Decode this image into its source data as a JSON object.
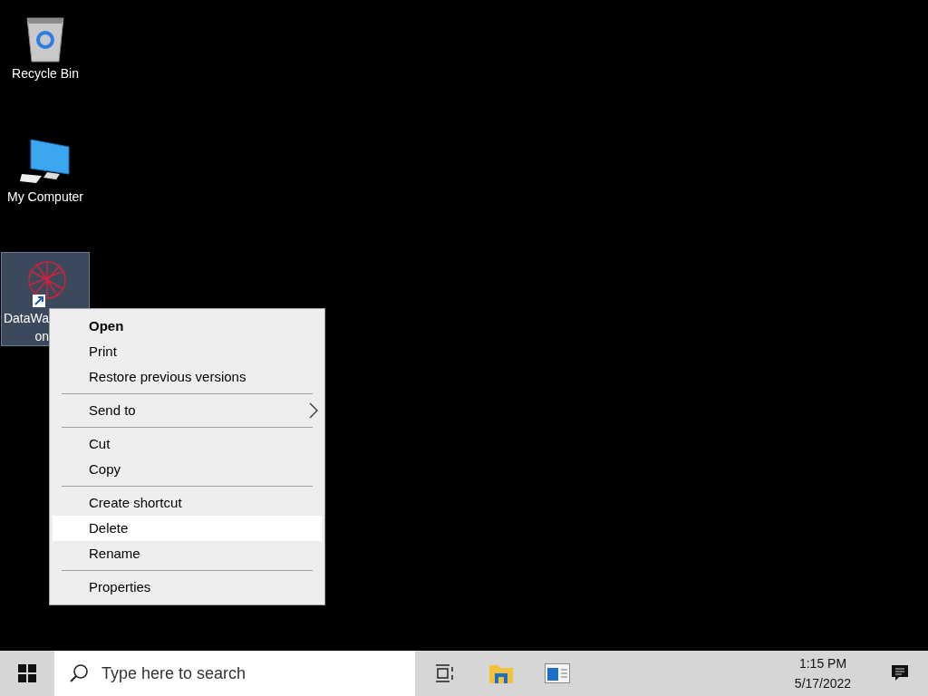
{
  "desktop_icons": [
    {
      "kind": "recycle-bin",
      "label_lines": [
        "Recycle Bin"
      ],
      "selected": false
    },
    {
      "kind": "computer",
      "label_lines": [
        "My Computer"
      ],
      "selected": false
    },
    {
      "kind": "shortcut",
      "label_lines": [
        "DataWa",
        "on"
      ],
      "selected": true
    }
  ],
  "context_menu": {
    "items": [
      {
        "kind": "item",
        "label": "Open",
        "default": true,
        "selected": false,
        "submenu": false
      },
      {
        "kind": "item",
        "label": "Print",
        "default": false,
        "selected": false,
        "submenu": false
      },
      {
        "kind": "item",
        "label": "Restore previous versions",
        "default": false,
        "selected": false,
        "submenu": false
      },
      {
        "kind": "separator"
      },
      {
        "kind": "item",
        "label": "Send to",
        "default": false,
        "selected": false,
        "submenu": true
      },
      {
        "kind": "separator"
      },
      {
        "kind": "item",
        "label": "Cut",
        "default": false,
        "selected": false,
        "submenu": false
      },
      {
        "kind": "item",
        "label": "Copy",
        "default": false,
        "selected": false,
        "submenu": false
      },
      {
        "kind": "separator"
      },
      {
        "kind": "item",
        "label": "Create shortcut",
        "default": false,
        "selected": false,
        "submenu": false
      },
      {
        "kind": "item",
        "label": "Delete",
        "default": false,
        "selected": true,
        "submenu": false
      },
      {
        "kind": "item",
        "label": "Rename",
        "default": false,
        "selected": false,
        "submenu": false
      },
      {
        "kind": "separator"
      },
      {
        "kind": "item",
        "label": "Properties",
        "default": false,
        "selected": false,
        "submenu": false
      }
    ]
  },
  "taskbar": {
    "search": {
      "placeholder": "Type here to search"
    },
    "pinned": [
      {
        "kind": "task-view"
      },
      {
        "kind": "file-explorer"
      },
      {
        "kind": "app-window"
      }
    ],
    "clock": {
      "time": "1:15 PM",
      "date": "5/17/2022"
    }
  }
}
